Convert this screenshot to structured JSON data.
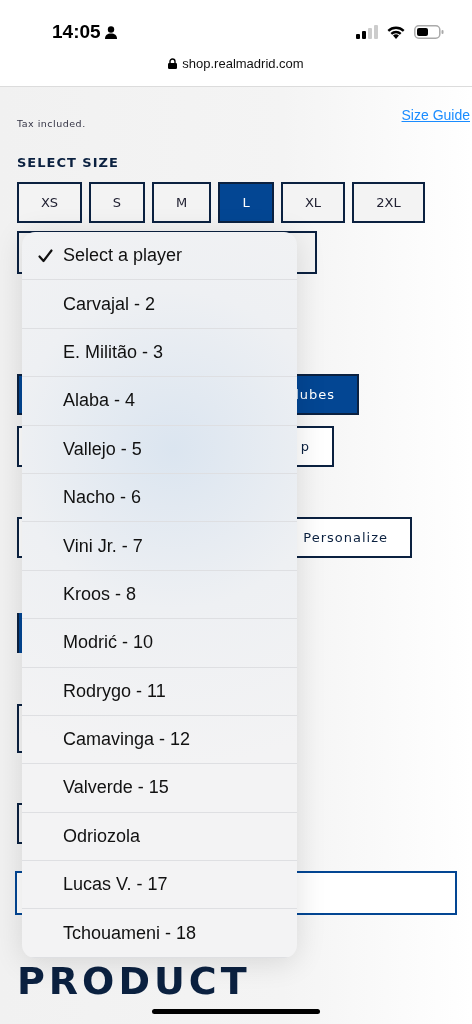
{
  "status_bar": {
    "time": "14:05"
  },
  "browser": {
    "url": "shop.realmadrid.com"
  },
  "product": {
    "tax_note": "Tax included.",
    "size_guide": "Size Guide",
    "size_heading": "SELECT SIZE",
    "sizes": [
      {
        "label": "XS",
        "selected": false
      },
      {
        "label": "S",
        "selected": false
      },
      {
        "label": "M",
        "selected": false
      },
      {
        "label": "L",
        "selected": true
      },
      {
        "label": "XL",
        "selected": false
      },
      {
        "label": "2XL",
        "selected": false
      }
    ],
    "options": [
      {
        "label": "lubes",
        "selected": true
      },
      {
        "label": "p",
        "selected": false
      },
      {
        "label": "Personalize",
        "selected": false
      }
    ],
    "description_heading": "PRODUCT"
  },
  "player_menu": {
    "items": [
      {
        "label": "Select a player",
        "selected": true
      },
      {
        "label": "Carvajal - 2",
        "selected": false
      },
      {
        "label": "E. Militão - 3",
        "selected": false
      },
      {
        "label": "Alaba - 4",
        "selected": false
      },
      {
        "label": "Vallejo - 5",
        "selected": false
      },
      {
        "label": "Nacho - 6",
        "selected": false
      },
      {
        "label": "Vini Jr. - 7",
        "selected": false
      },
      {
        "label": "Kroos - 8",
        "selected": false
      },
      {
        "label": "Modrić - 10",
        "selected": false
      },
      {
        "label": "Rodrygo - 11",
        "selected": false
      },
      {
        "label": "Camavinga - 12",
        "selected": false
      },
      {
        "label": "Valverde - 15",
        "selected": false
      },
      {
        "label": "Odriozola",
        "selected": false
      },
      {
        "label": "Lucas V. - 17",
        "selected": false
      },
      {
        "label": "Tchouameni - 18",
        "selected": false
      }
    ]
  }
}
